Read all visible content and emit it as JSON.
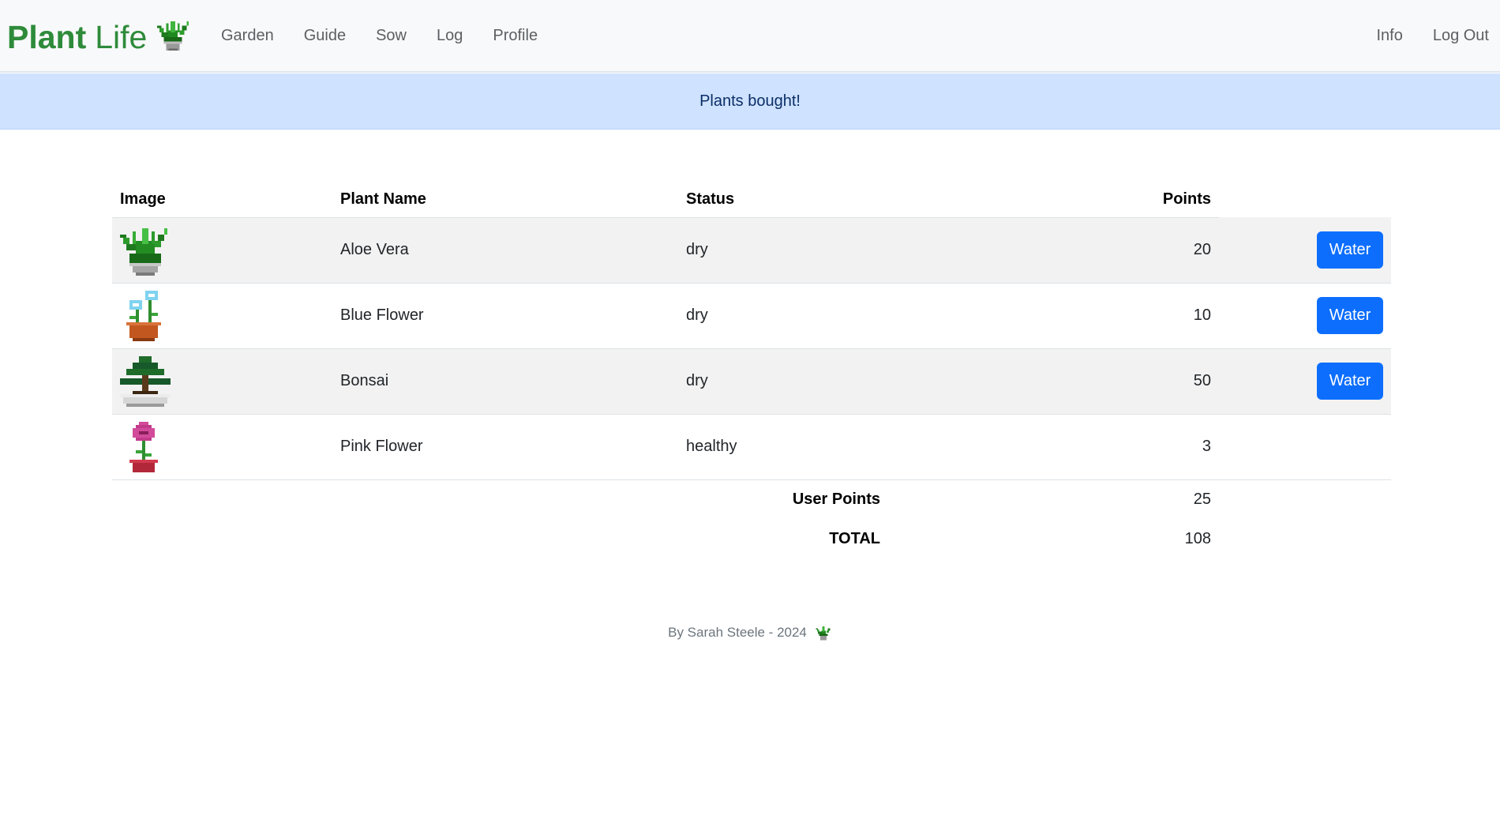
{
  "navbar": {
    "brand_bold": "Plant",
    "brand_light": "Life",
    "brand_icon": "potted-plant-icon",
    "links_left": [
      "Garden",
      "Guide",
      "Sow",
      "Log",
      "Profile"
    ],
    "links_right": [
      "Info",
      "Log Out"
    ]
  },
  "alert": {
    "message": "Plants bought!"
  },
  "table": {
    "headers": {
      "image": "Image",
      "name": "Plant Name",
      "status": "Status",
      "points": "Points"
    },
    "rows": [
      {
        "image_icon": "aloe-vera-icon",
        "name": "Aloe Vera",
        "status": "dry",
        "points": "20",
        "action": "Water"
      },
      {
        "image_icon": "blue-flower-icon",
        "name": "Blue Flower",
        "status": "dry",
        "points": "10",
        "action": "Water"
      },
      {
        "image_icon": "bonsai-icon",
        "name": "Bonsai",
        "status": "dry",
        "points": "50",
        "action": "Water"
      },
      {
        "image_icon": "pink-flower-icon",
        "name": "Pink Flower",
        "status": "healthy",
        "points": "3",
        "action": ""
      }
    ],
    "summary": {
      "user_points_label": "User Points",
      "user_points_value": "25",
      "total_label": "TOTAL",
      "total_value": "108"
    }
  },
  "footer": {
    "text": "By Sarah Steele - 2024",
    "icon": "potted-plant-icon"
  },
  "colors": {
    "brand": "#2e8b3a",
    "primary_button": "#0d6efd",
    "alert_bg": "#cfe2ff"
  }
}
